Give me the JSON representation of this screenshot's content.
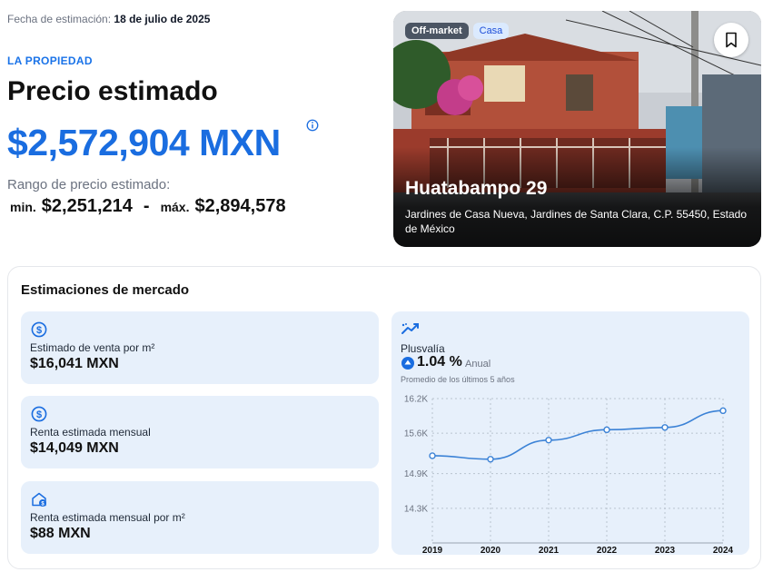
{
  "header": {
    "date_label": "Fecha de estimación:",
    "date_value": "18 de julio de 2025",
    "kicker": "LA PROPIEDAD",
    "title": "Precio estimado",
    "price": "$2,572,904 MXN",
    "range_label": "Rango de precio estimado:",
    "range_min_prefix": "min.",
    "range_min": "$2,251,214",
    "range_sep": "-",
    "range_max_prefix": "máx.",
    "range_max": "$2,894,578"
  },
  "property": {
    "badge_status": "Off-market",
    "badge_type": "Casa",
    "street": "Huatabampo 29",
    "address": "Jardines de Casa Nueva, Jardines de Santa Clara, C.P. 55450, Estado de México",
    "icons": {
      "bookmark": "bookmark-icon"
    }
  },
  "market": {
    "title": "Estimaciones de mercado",
    "stats": [
      {
        "label": "Estimado de venta por m²",
        "value": "$16,041 MXN",
        "icon": "dollar-circle-icon"
      },
      {
        "label": "Renta estimada mensual",
        "value": "$14,049 MXN",
        "icon": "dollar-circle-icon"
      },
      {
        "label": "Renta estimada mensual por m²",
        "value": "$88 MXN",
        "icon": "house-dollar-icon"
      }
    ],
    "plusvalia": {
      "label": "Plusvalía",
      "value": "1.04 %",
      "period": "Anual",
      "note": "Promedio de los últimos 5 años"
    }
  },
  "colors": {
    "accent": "#1a6de0",
    "card_bg": "#e7f0fb",
    "line": "#3b82d6"
  },
  "chart_data": {
    "type": "line",
    "x": [
      "2019",
      "2020",
      "2021",
      "2022",
      "2023",
      "2024"
    ],
    "series": [
      {
        "values": [
          15210,
          15150,
          15480,
          15660,
          15700,
          15990
        ]
      }
    ],
    "yticks": [
      "16.2K",
      "15.6K",
      "14.9K",
      "14.3K"
    ],
    "ytick_values": [
      16200,
      15600,
      14900,
      14300
    ],
    "ylim": [
      13700,
      16200
    ],
    "grid": true
  }
}
